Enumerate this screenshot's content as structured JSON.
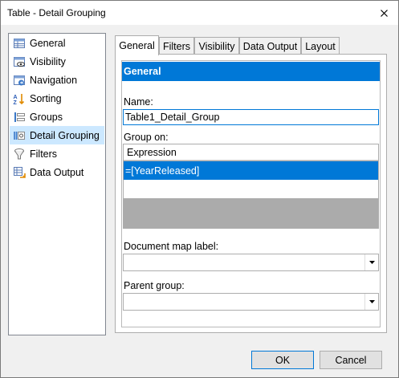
{
  "window": {
    "title": "Table - Detail Grouping"
  },
  "nav": {
    "items": [
      {
        "label": "General",
        "icon": "general-icon"
      },
      {
        "label": "Visibility",
        "icon": "visibility-icon"
      },
      {
        "label": "Navigation",
        "icon": "navigation-icon"
      },
      {
        "label": "Sorting",
        "icon": "sorting-icon"
      },
      {
        "label": "Groups",
        "icon": "groups-icon"
      },
      {
        "label": "Detail Grouping",
        "icon": "detail-grouping-icon"
      },
      {
        "label": "Filters",
        "icon": "filters-icon"
      },
      {
        "label": "Data Output",
        "icon": "data-output-icon"
      }
    ],
    "selected": "Detail Grouping"
  },
  "tabs": [
    {
      "label": "General"
    },
    {
      "label": "Filters"
    },
    {
      "label": "Visibility"
    },
    {
      "label": "Data Output"
    },
    {
      "label": "Layout"
    }
  ],
  "panel": {
    "header": "General",
    "name_label": "Name:",
    "name_value": "Table1_Detail_Group",
    "group_on_label": "Group on:",
    "grid_column": "Expression",
    "grid_rows": [
      "=[YearReleased]"
    ],
    "doc_map_label": "Document map label:",
    "doc_map_value": "",
    "parent_group_label": "Parent group:",
    "parent_group_value": ""
  },
  "buttons": {
    "ok": "OK",
    "cancel": "Cancel"
  },
  "colors": {
    "accent": "#0078d7",
    "selection": "#cce8ff",
    "empty_grid": "#ababab"
  }
}
